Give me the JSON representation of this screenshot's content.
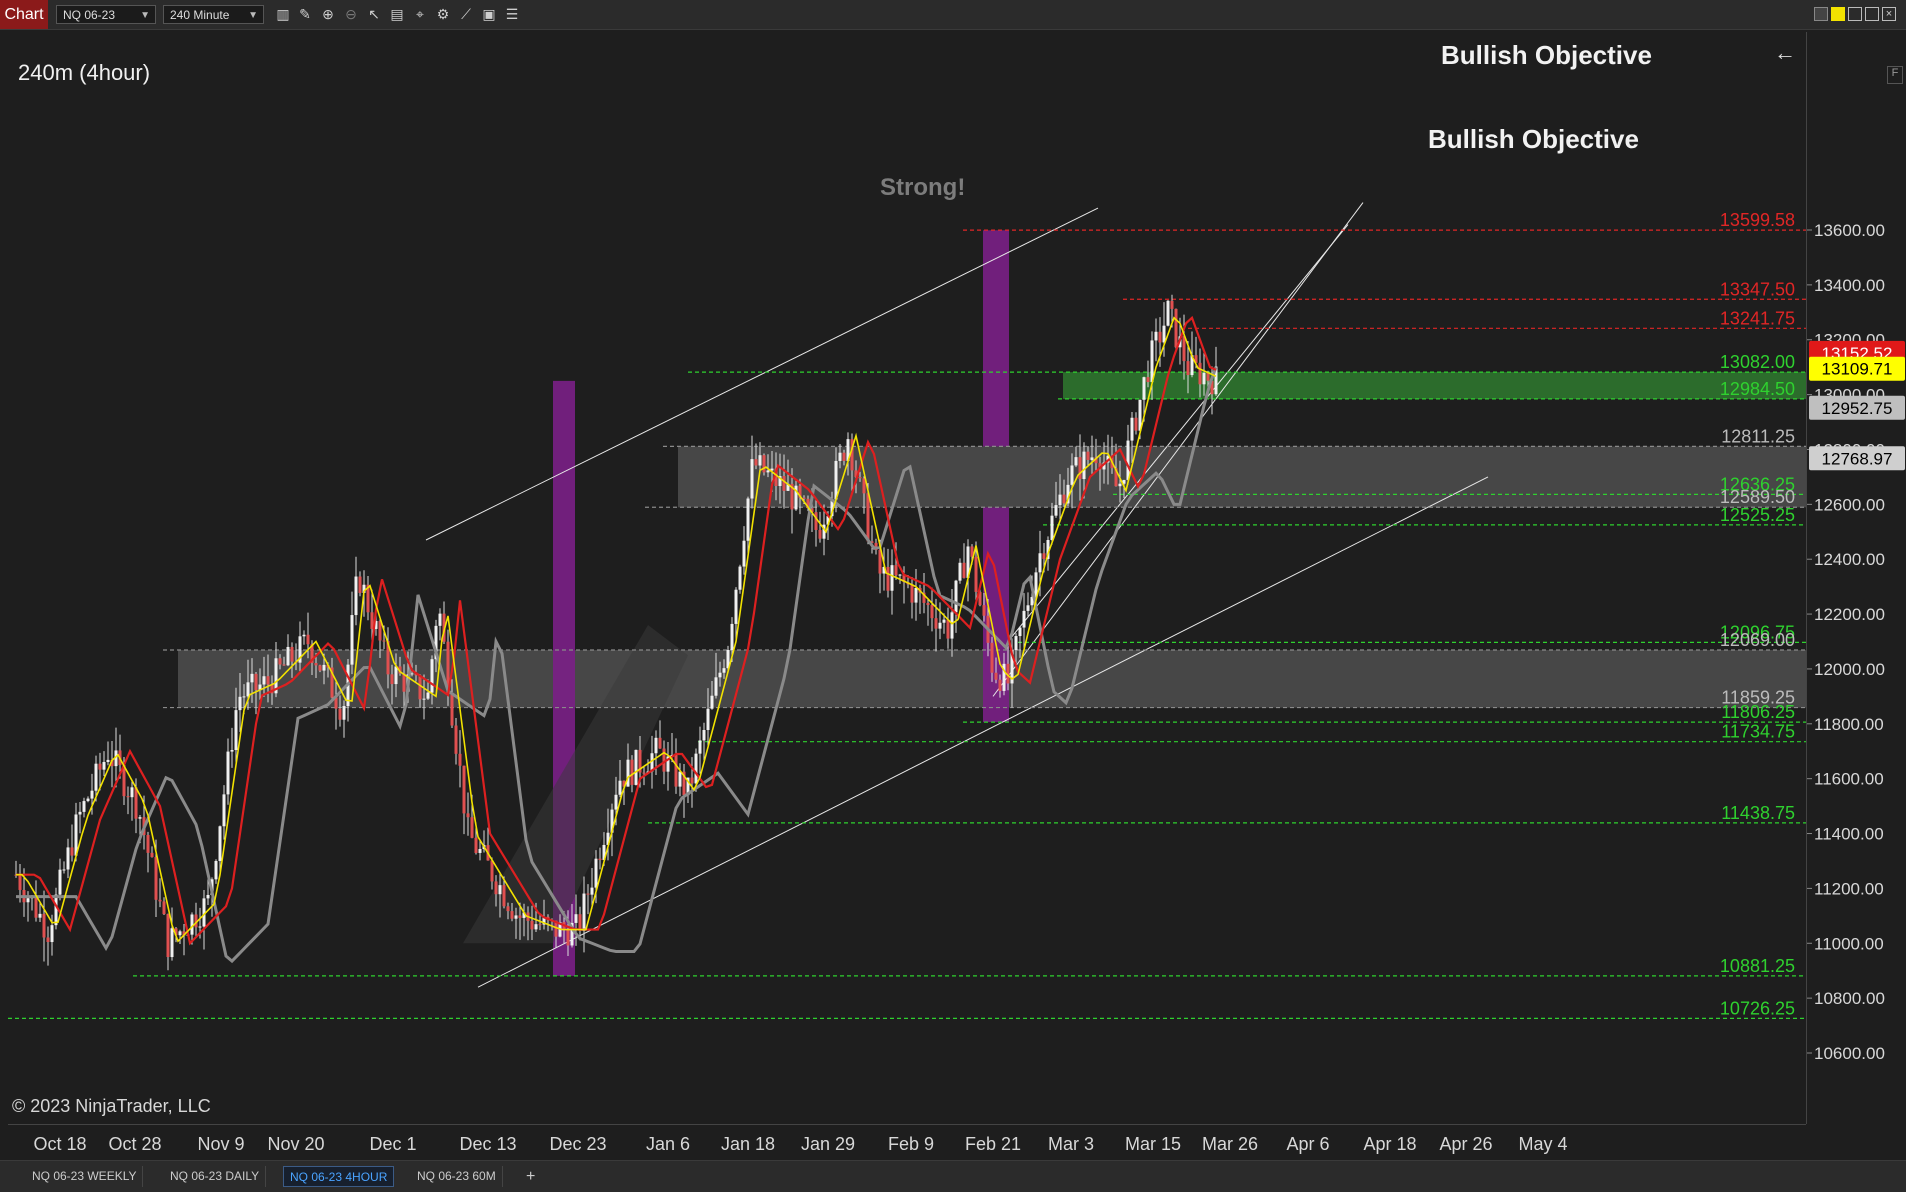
{
  "app": {
    "tab_label": "Chart"
  },
  "toolbar": {
    "instrument": "NQ 06-23",
    "interval": "240 Minute"
  },
  "chart": {
    "title": "240m (4hour)",
    "copyright": "© 2023 NinjaTrader, LLC",
    "annotations": {
      "strong": "Strong!",
      "bullish_1": "Bullish Objective",
      "bullish_2": "Bullish Objective"
    },
    "y_ticks": [
      "13600.00",
      "13400.00",
      "13200.00",
      "13000.00",
      "12800.00",
      "12600.00",
      "12400.00",
      "12200.00",
      "12000.00",
      "11800.00",
      "11600.00",
      "11400.00",
      "11200.00",
      "11000.00",
      "10800.00",
      "10600.00"
    ],
    "x_ticks": [
      "Oct 18",
      "Oct 28",
      "Nov 9",
      "Nov 20",
      "Dec 1",
      "Dec 13",
      "Dec 23",
      "Jan 6",
      "Jan 18",
      "Jan 29",
      "Feb 9",
      "Feb 21",
      "Mar 3",
      "Mar 15",
      "Mar 26",
      "Apr 6",
      "Apr 18",
      "Apr 26",
      "May 4"
    ],
    "levels": {
      "l13599": "13599.58",
      "l13347": "13347.50",
      "l13241": "13241.75",
      "l13082": "13082.00",
      "l12984": "12984.50",
      "l12811": "12811.25",
      "l12636": "12636.25",
      "l12589": "12589.50",
      "l12525": "12525.25",
      "l12096": "12096.75",
      "l12069": "12069.00",
      "l11859": "11859.25",
      "l11806": "11806.25",
      "l11734": "11734.75",
      "l11438": "11438.75",
      "l10881": "10881.25",
      "l10726": "10726.25"
    },
    "price_tags": {
      "red": "13152.52",
      "yellow": "13109.71",
      "grey1": "12952.75",
      "grey2": "12768.97"
    },
    "colors": {
      "bull": "#2fd12f",
      "bear": "#e02626",
      "ema_fast": "#f2e200",
      "ema_mid": "#dd2020",
      "sma_slow": "#8a8a8a",
      "zone": "#6a6a6a",
      "purple": "#7a1f86"
    }
  },
  "bottom_tabs": [
    "NQ 06-23 WEEKLY",
    "NQ 06-23 DAILY",
    "NQ 06-23 4HOUR",
    "NQ 06-23 60M"
  ],
  "bottom_plus": "+",
  "f_button": "F"
}
